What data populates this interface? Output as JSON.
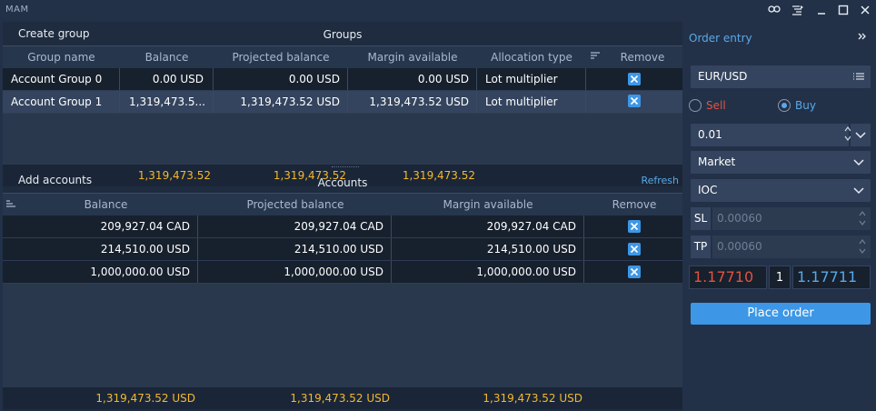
{
  "app": {
    "title": "MAM"
  },
  "groups": {
    "create_label": "Create group",
    "title": "Groups",
    "columns": [
      "Group name",
      "Balance",
      "Projected balance",
      "Margin available",
      "Allocation type",
      "Remove"
    ],
    "rows": [
      {
        "name": "Account Group 0",
        "balance": "0.00 USD",
        "projected": "0.00 USD",
        "margin": "0.00 USD",
        "allocation": "Lot multiplier",
        "selected": false
      },
      {
        "name": "Account Group 1",
        "balance": "1,319,473.5...",
        "projected": "1,319,473.52 USD",
        "margin": "1,319,473.52 USD",
        "allocation": "Lot multiplier",
        "selected": true
      }
    ],
    "totals": {
      "balance": "1,319,473.52",
      "projected": "1,319,473.52",
      "margin": "1,319,473.52"
    }
  },
  "accounts": {
    "add_label": "Add accounts",
    "title": "Accounts",
    "refresh_label": "Refresh",
    "columns": [
      "Balance",
      "Projected balance",
      "Margin available",
      "Remove"
    ],
    "rows": [
      {
        "balance": "209,927.04 CAD",
        "projected": "209,927.04 CAD",
        "margin": "209,927.04 CAD"
      },
      {
        "balance": "214,510.00 USD",
        "projected": "214,510.00 USD",
        "margin": "214,510.00 USD"
      },
      {
        "balance": "1,000,000.00 USD",
        "projected": "1,000,000.00 USD",
        "margin": "1,000,000.00 USD"
      }
    ],
    "totals": {
      "balance": "1,319,473.52 USD",
      "projected": "1,319,473.52 USD",
      "margin": "1,319,473.52 USD"
    }
  },
  "order_entry": {
    "title": "Order entry",
    "symbol": "EUR/USD",
    "sell_label": "Sell",
    "buy_label": "Buy",
    "side_selected": "Buy",
    "quantity": "0.01",
    "order_type": "Market",
    "time_in_force": "IOC",
    "sl_label": "SL",
    "sl_placeholder": "0.00060",
    "tp_label": "TP",
    "tp_placeholder": "0.00060",
    "sell_price": "1.17710",
    "spread": "1",
    "buy_price": "1.17711",
    "place_label": "Place order"
  },
  "colors": {
    "accent": "#3d97e6",
    "totals": "#f5b82e",
    "sell": "#e05340",
    "buy": "#5aa8e6"
  }
}
